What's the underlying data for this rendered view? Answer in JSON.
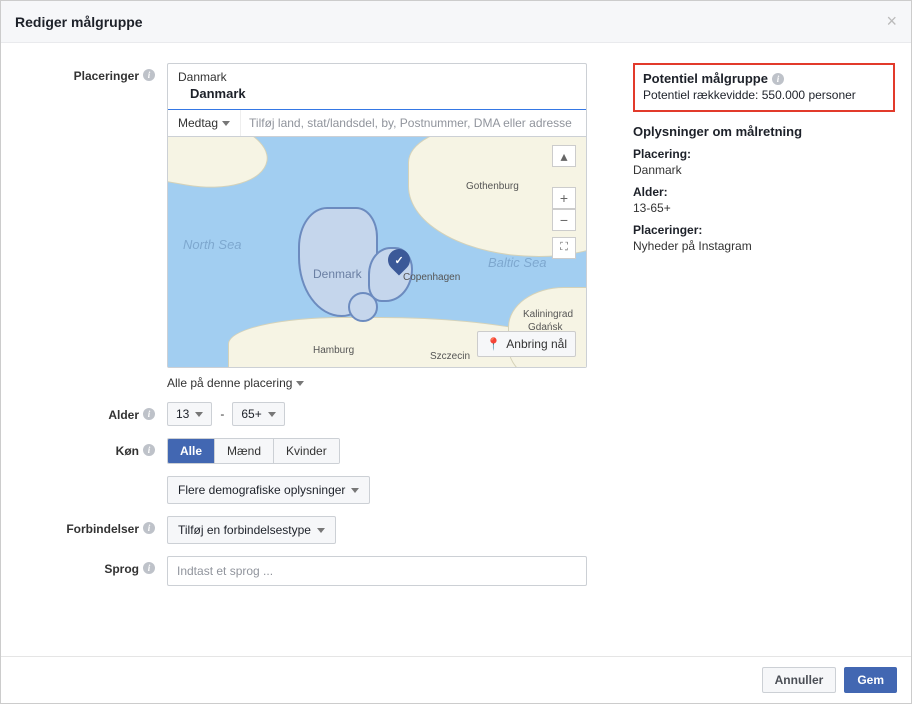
{
  "modal": {
    "title": "Rediger målgruppe",
    "cancel": "Annuller",
    "save": "Gem"
  },
  "labels": {
    "placements": "Placeringer",
    "age": "Alder",
    "gender": "Køn",
    "connections": "Forbindelser",
    "language": "Sprog"
  },
  "location": {
    "header": "Danmark",
    "country": "Danmark",
    "include_label": "Medtag",
    "search_placeholder": "Tilføj land, stat/landsdel, by, Postnummer, DMA eller adresse",
    "drop_pin": "Anbring nål",
    "everyone_label": "Alle på denne placering"
  },
  "map_labels": {
    "north_sea": "North Sea",
    "baltic_sea": "Baltic Sea",
    "denmark": "Denmark",
    "copenhagen": "Copenhagen",
    "gothenburg": "Gothenburg",
    "hamburg": "Hamburg",
    "kaliningrad": "Kaliningrad",
    "gdansk": "Gdańsk",
    "szczecin": "Szczecin"
  },
  "age": {
    "min": "13",
    "max": "65+"
  },
  "gender": {
    "all": "Alle",
    "men": "Mænd",
    "women": "Kvinder"
  },
  "demo_more": "Flere demografiske oplysninger",
  "connections_select": "Tilføj en forbindelsestype",
  "language_placeholder": "Indtast et sprog ...",
  "sidebar": {
    "potential_title": "Potentiel målgruppe",
    "potential_reach": "Potentiel rækkevidde: 550.000 personer",
    "targeting_title": "Oplysninger om målretning",
    "placement_label": "Placering:",
    "placement_value": "Danmark",
    "age_label": "Alder:",
    "age_value": "13-65+",
    "placements_label": "Placeringer:",
    "placements_value": "Nyheder på Instagram"
  }
}
